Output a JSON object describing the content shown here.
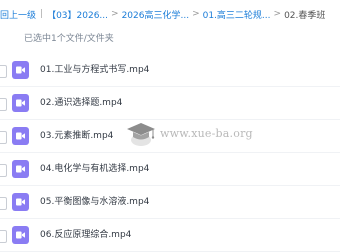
{
  "breadcrumb": {
    "back_label": "回上一级",
    "items": [
      "【03】2026...",
      "2026高三化学...",
      "01.高三二轮规...",
      "02.春季班"
    ]
  },
  "status": {
    "selection_text": "已选中1个文件/文件夹"
  },
  "files": [
    {
      "name": "01.工业与方程式书写.mp4",
      "icon": "video-file-icon"
    },
    {
      "name": "02.通识选择题.mp4",
      "icon": "video-file-icon"
    },
    {
      "name": "03.元素推断.mp4",
      "icon": "video-file-icon"
    },
    {
      "name": "04.电化学与有机选择.mp4",
      "icon": "video-file-icon"
    },
    {
      "name": "05.平衡图像与水溶液.mp4",
      "icon": "video-file-icon"
    },
    {
      "name": "06.反应原理综合.mp4",
      "icon": "video-file-icon"
    }
  ],
  "watermark": {
    "text": "www.xue-ba.org"
  },
  "colors": {
    "link": "#1a7cd8",
    "video_icon": "#8a7cf3",
    "status_text": "#7b8694"
  }
}
